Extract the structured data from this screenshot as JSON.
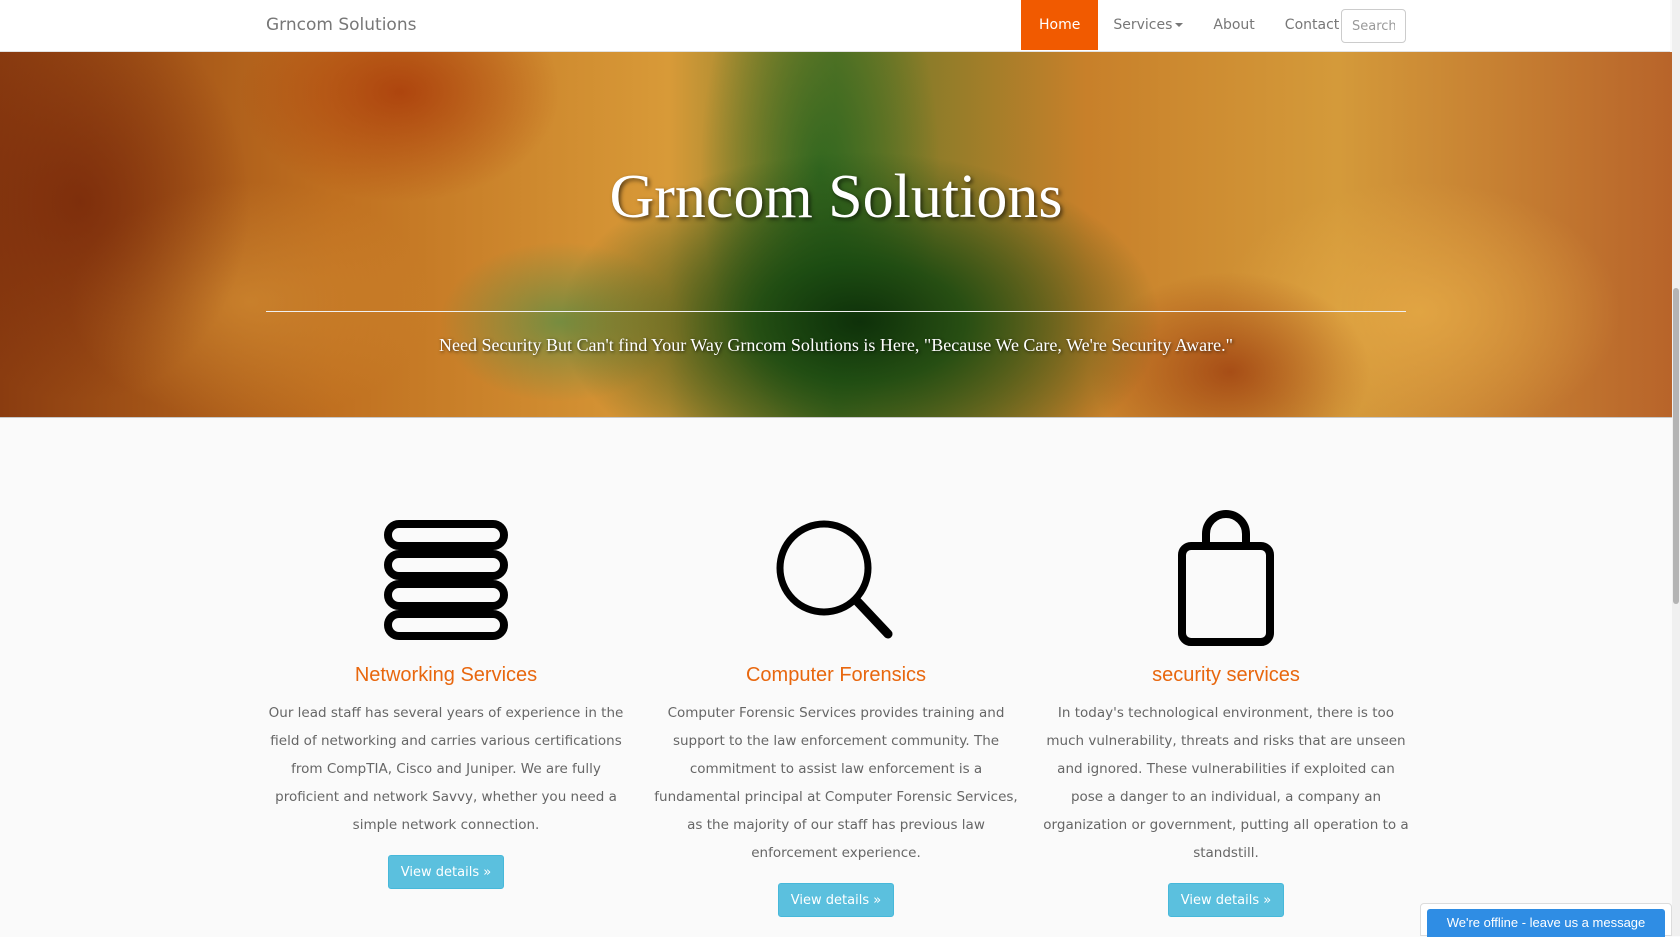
{
  "navbar": {
    "brand": "Grncom Solutions",
    "items": [
      {
        "label": "Home",
        "active": true
      },
      {
        "label": "Services",
        "dropdown": true
      },
      {
        "label": "About"
      },
      {
        "label": "Contact"
      }
    ],
    "search": {
      "placeholder": "Search",
      "value": ""
    }
  },
  "hero": {
    "title": "Grncom Solutions",
    "subtitle": "Need Security But Can't find Your Way Grncom Solutions is Here, \"Because We Care, We're Security Aware.\""
  },
  "features": [
    {
      "icon": "menu-lines-icon",
      "title": "Networking Services",
      "text": "Our lead staff has several years of experience in the field of networking and carries various certifications from CompTIA, Cisco and Juniper. We are fully proficient and network Savvy, whether you need a simple network connection.",
      "button": "View details »"
    },
    {
      "icon": "search-icon",
      "title": "Computer Forensics",
      "text": "Computer Forensic Services provides training and support to the law enforcement community. The commitment to assist law enforcement is a fundamental principal at Computer Forensic Services, as the majority of our staff has previous law enforcement experience.",
      "button": "View details »"
    },
    {
      "icon": "shopping-bag-icon",
      "title": "security services",
      "text": "In today's technological environment, there is too much vulnerability, threats and risks that are unseen and ignored. These vulnerabilities if exploited can pose a danger to an individual, a company an organization or government, putting all operation to a standstill.",
      "button": "View details »"
    }
  ],
  "chat": {
    "label": "We're offline - leave us a message"
  },
  "colors": {
    "accent": "#f15a00",
    "feature_title": "#e8670e",
    "button": "#5bc0de",
    "chat": "#2f8de4"
  }
}
